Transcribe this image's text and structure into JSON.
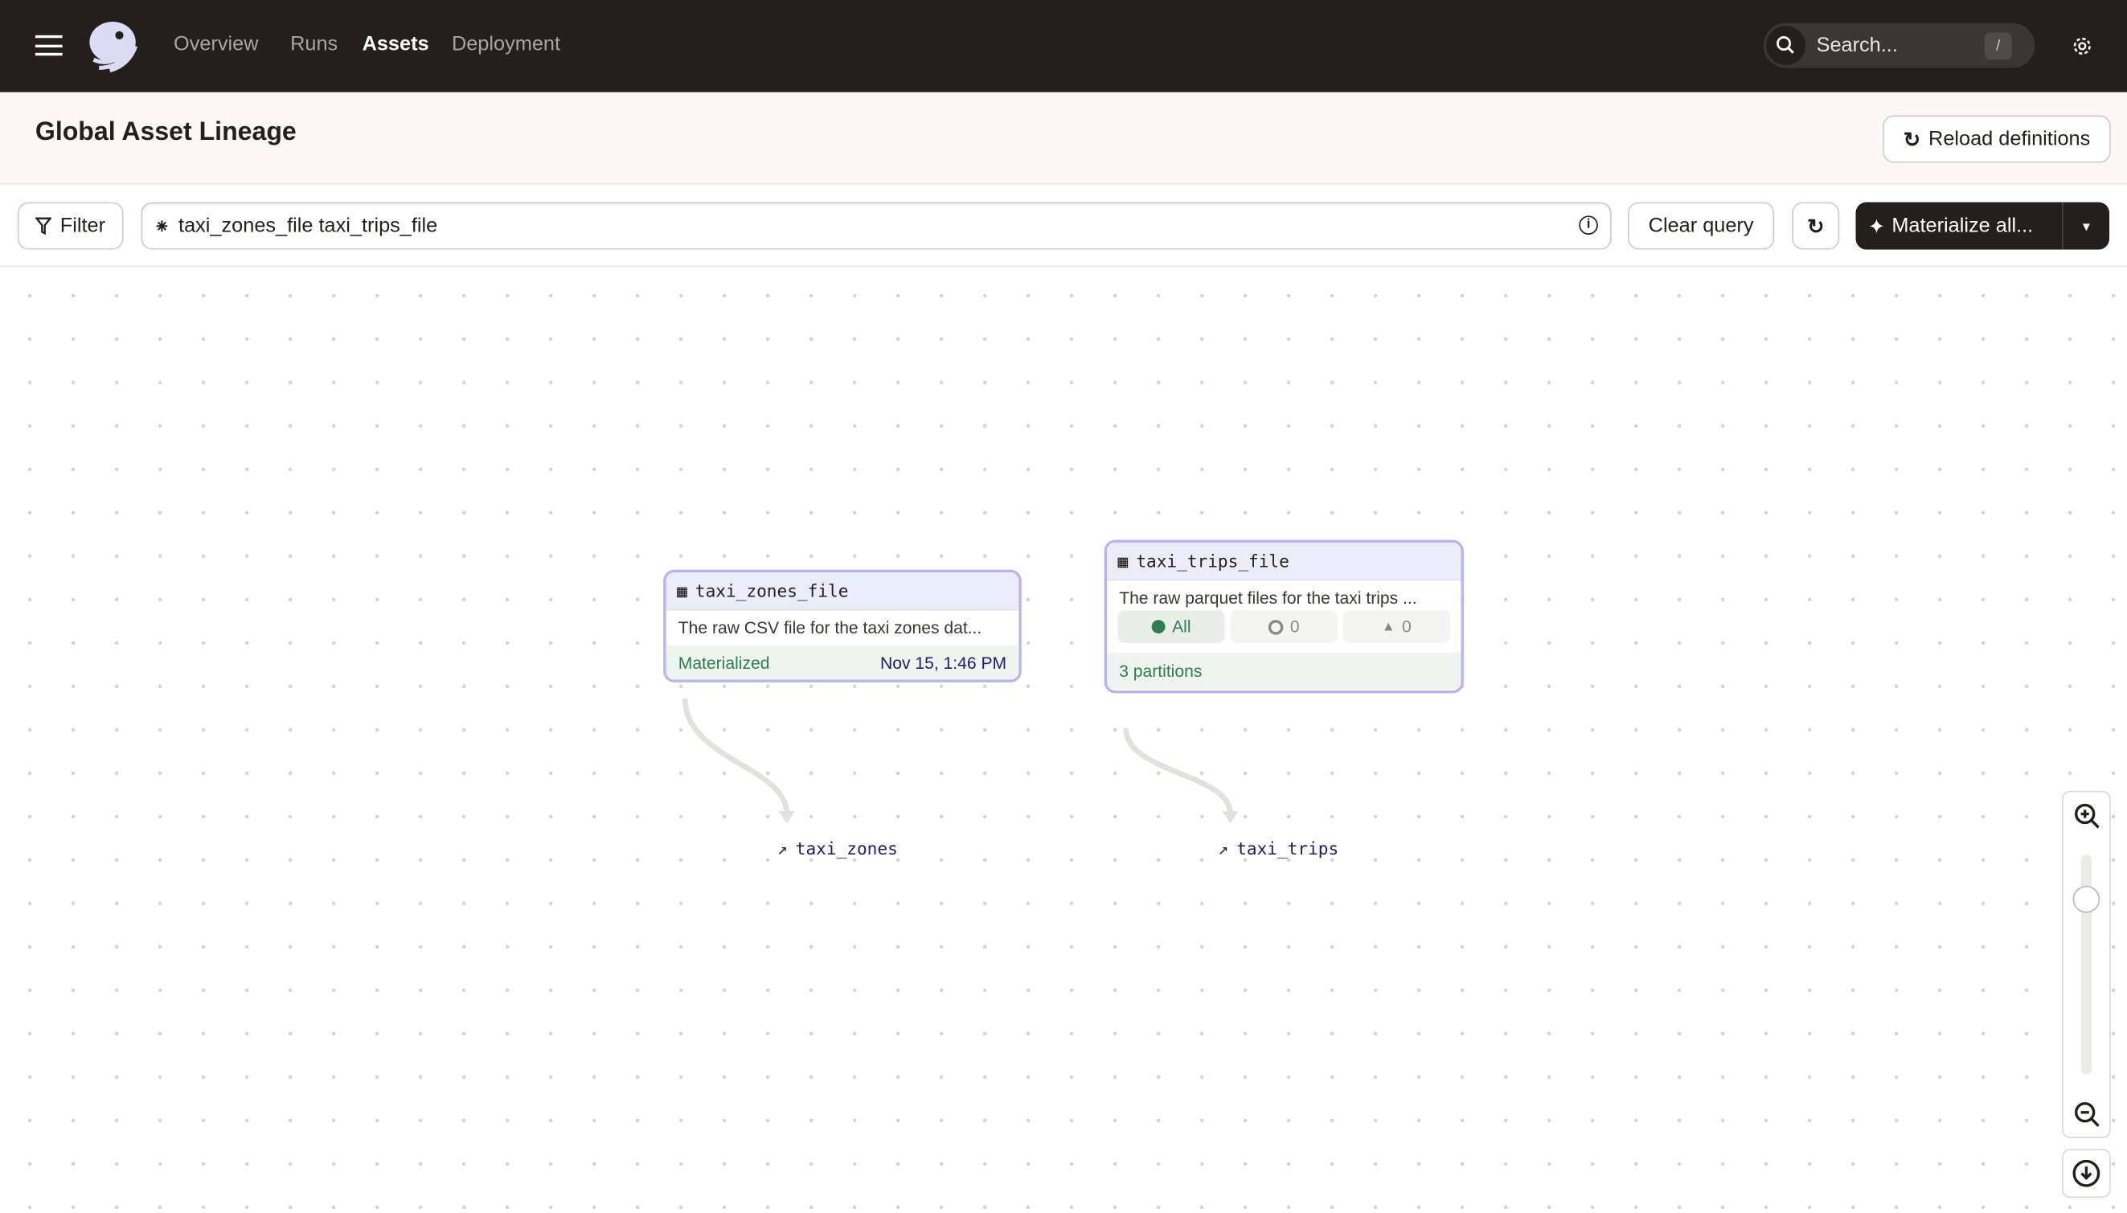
{
  "topbar": {
    "nav": [
      "Overview",
      "Runs",
      "Assets",
      "Deployment"
    ],
    "active_nav": "Assets",
    "search_placeholder": "Search...",
    "search_shortcut": "/"
  },
  "header": {
    "title": "Global Asset Lineage",
    "reload_label": "Reload definitions"
  },
  "toolbar": {
    "filter_label": "Filter",
    "query_value": "taxi_zones_file taxi_trips_file",
    "clear_label": "Clear query",
    "materialize_label": "Materialize all..."
  },
  "graph": {
    "nodes": [
      {
        "name": "taxi_zones_file",
        "description": "The raw CSV file for the taxi zones dat...",
        "status": "Materialized",
        "timestamp": "Nov 15, 1:46 PM"
      },
      {
        "name": "taxi_trips_file",
        "description": "The raw parquet files for the taxi trips ...",
        "chips": [
          {
            "label": "All"
          },
          {
            "label": "0"
          },
          {
            "label": "0"
          }
        ],
        "partitions": "3 partitions"
      }
    ],
    "downstream": [
      "taxi_zones",
      "taxi_trips"
    ]
  },
  "zoom": {
    "level": 0.8
  },
  "colors": {
    "topbar": "#231f1b",
    "node_border": "#b9b4ef",
    "materialized": "#2e7d4f",
    "link": "#1d1d6b"
  }
}
